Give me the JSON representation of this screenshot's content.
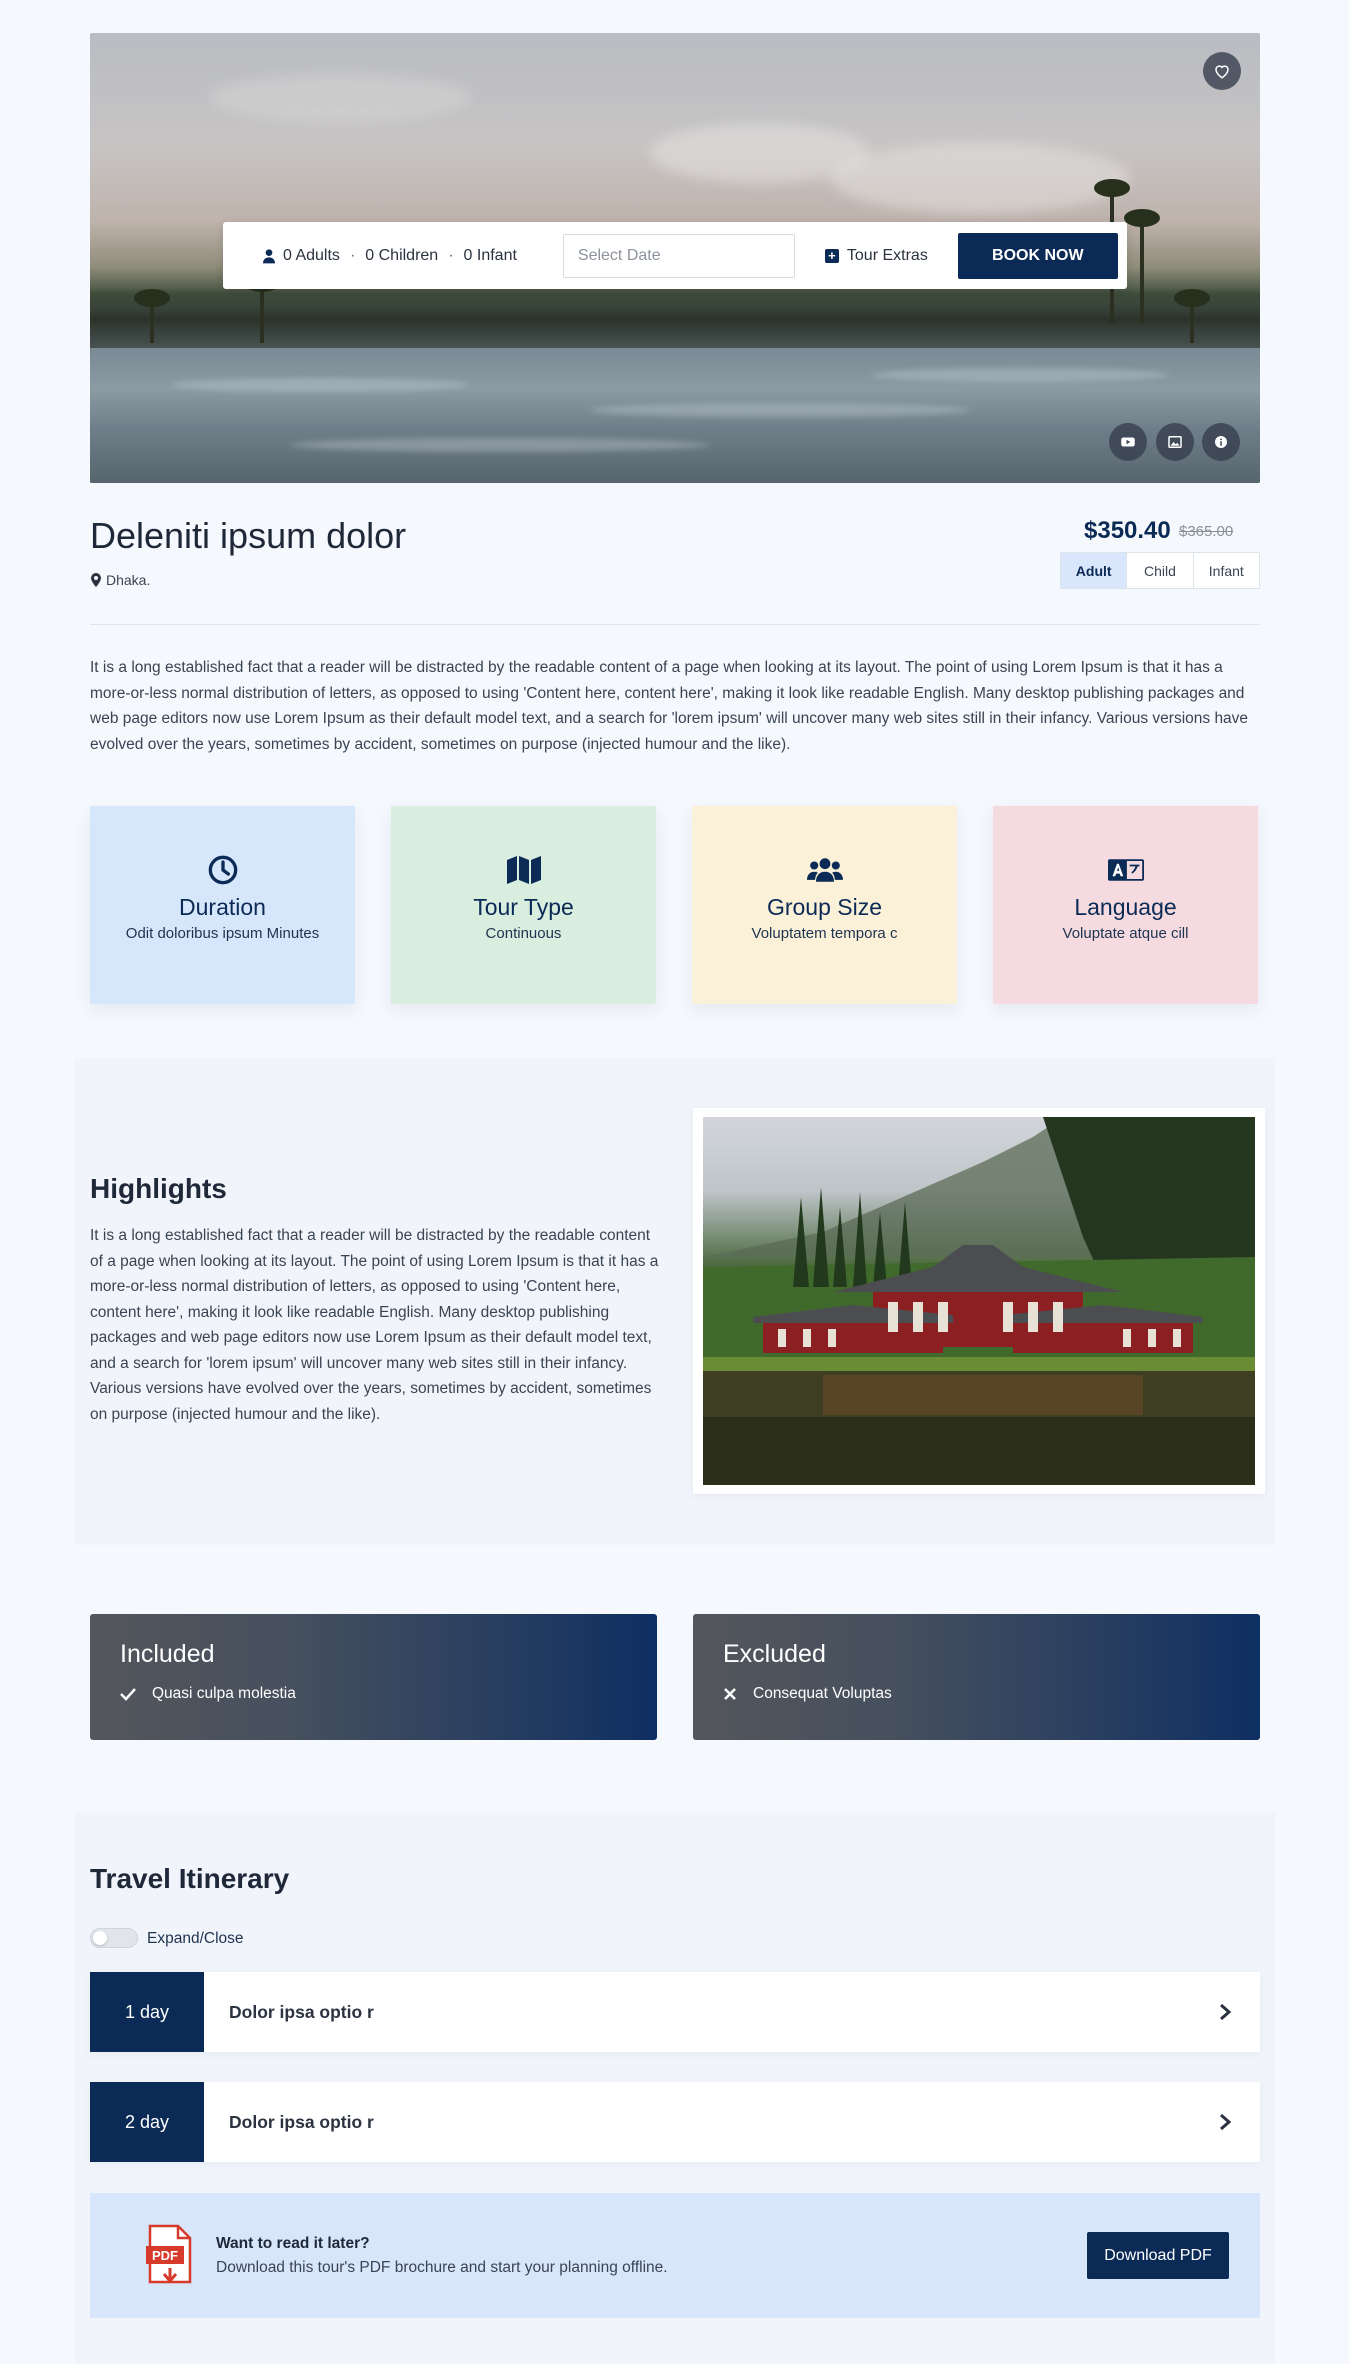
{
  "hero": {
    "favorite_icon": "heart-icon",
    "media_icons": [
      "youtube-icon",
      "gallery-icon",
      "info-icon"
    ]
  },
  "booking": {
    "guests_icon": "user-icon",
    "adults": "0 Adults",
    "children": "0 Children",
    "infants": "0 Infant",
    "separator": "·",
    "date_placeholder": "Select Date",
    "extras_icon": "plus-square-icon",
    "extras_label": "Tour Extras",
    "book_label": "BOOK NOW"
  },
  "tour": {
    "title": "Deleniti ipsum dolor",
    "location_icon": "map-pin-icon",
    "location": "Dhaka.",
    "price": "$350.40",
    "old_price": "$365.00",
    "price_tabs": [
      "Adult",
      "Child",
      "Infant"
    ],
    "active_price_tab": "Adult",
    "description": "It is a long established fact that a reader will be distracted by the readable content of a page when looking at its layout. The point of using Lorem Ipsum is that it has a more-or-less normal distribution of letters, as opposed to using 'Content here, content here', making it look like readable English. Many desktop publishing packages and web page editors now use Lorem Ipsum as their default model text, and a search for 'lorem ipsum' will uncover many web sites still in their infancy. Various versions have evolved over the years, sometimes by accident, sometimes on purpose (injected humour and the like)."
  },
  "features": [
    {
      "icon": "clock-icon",
      "title": "Duration",
      "value": "Odit doloribus ipsum Minutes",
      "bg": "#d6e6fb"
    },
    {
      "icon": "map-icon",
      "title": "Tour Type",
      "value": "Continuous",
      "bg": "#d9eedf"
    },
    {
      "icon": "users-icon",
      "title": "Group Size",
      "value": "Voluptatem tempora c",
      "bg": "#fbf1d9"
    },
    {
      "icon": "language-icon",
      "title": "Language",
      "value": "Voluptate atque cill",
      "bg": "#f5dbe0"
    }
  ],
  "highlights": {
    "title": "Highlights",
    "text": "It is a long established fact that a reader will be distracted by the readable content of a page when looking at its layout. The point of using Lorem Ipsum is that it has a more-or-less normal distribution of letters, as opposed to using 'Content here, content here', making it look like readable English. Many desktop publishing packages and web page editors now use Lorem Ipsum as their default model text, and a search for 'lorem ipsum' will uncover many web sites still in their infancy. Various versions have evolved over the years, sometimes by accident, sometimes on purpose (injected humour and the like)."
  },
  "included": {
    "title": "Included",
    "items": [
      "Quasi culpa molestia"
    ],
    "icon": "check-icon"
  },
  "excluded": {
    "title": "Excluded",
    "items": [
      "Consequat Voluptas"
    ],
    "icon": "x-icon"
  },
  "itinerary": {
    "title": "Travel Itinerary",
    "toggle_label": "Expand/Close",
    "days": [
      {
        "badge": "1 day",
        "title": "Dolor ipsa optio r"
      },
      {
        "badge": "2 day",
        "title": "Dolor ipsa optio r"
      }
    ]
  },
  "pdf": {
    "icon": "pdf-icon",
    "question": "Want to read it later?",
    "subtitle": "Download this tour's PDF brochure and start your planning offline.",
    "button": "Download PDF"
  },
  "colors": {
    "primary": "#0c2a56",
    "background": "#f5f8fd"
  }
}
